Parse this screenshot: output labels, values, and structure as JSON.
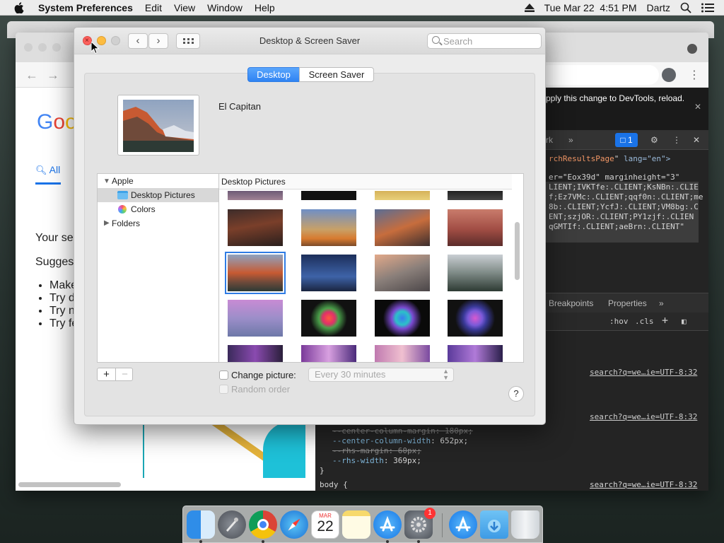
{
  "menubar": {
    "app": "System Preferences",
    "items": [
      "Edit",
      "View",
      "Window",
      "Help"
    ],
    "datetime": "Tue Mar 22  4:51 PM",
    "user": "Dartz"
  },
  "window": {
    "title": "Desktop & Screen Saver",
    "search_placeholder": "Search",
    "tabs": [
      "Desktop",
      "Screen Saver"
    ],
    "selected_tab": "Desktop",
    "current_picture": "El Capitan",
    "source_list": {
      "apple": "Apple",
      "desktop_pictures": "Desktop Pictures",
      "colors": "Colors",
      "folders": "Folders"
    },
    "grid_header": "Desktop Pictures",
    "plus": "+",
    "minus": "−",
    "change_picture_label": "Change picture:",
    "change_picture_interval": "Every 30 minutes",
    "random_order_label": "Random order",
    "help": "?"
  },
  "chrome": {
    "search_tab_all": "All",
    "result_text_1": "Your se",
    "result_text_2": "Sugges",
    "bullets": [
      "Make",
      "Try d",
      "Try n",
      "Try fe"
    ]
  },
  "devtools": {
    "message": "pply this change to DevTools, reload.",
    "tab_partial": "rk",
    "badge_count": "1",
    "html_line_1_attr": "rchResultsPage",
    "html_line_1_lang": "lang=\"en\">",
    "html_lines": [
      "er=\"Eox39d\" marginheight=\"3\"",
      "LIENT;IVKTfe:.CLIENT;KsNBn:.CLIE",
      "f;Ez7VMc:.CLIENT;qqf0n:.CLIENT;me",
      "8b:.CLIENT;YcfJ:.CLIENT;VM8bg:.C",
      "ENT;szjOR:.CLIENT;PY1zjf:.CLIEN",
      "qGMTIf:.CLIENT;aeBrn:.CLIENT\""
    ],
    "subtabs": [
      "Breakpoints",
      "Properties"
    ],
    "filter_hov": ":hov",
    "filter_cls": ".cls",
    "link": "search?q=we…ie=UTF-8:32",
    "css_lines": [
      {
        "prop": "--center-column-margin",
        "val": "180px;",
        "struck": true
      },
      {
        "prop": "--center-column-width",
        "val": "652px;",
        "struck": false
      },
      {
        "prop": "--rhs-margin",
        "val": "60px;",
        "struck": true
      },
      {
        "prop": "--rhs-width",
        "val": "369px;",
        "struck": false
      }
    ],
    "close_brace": "}",
    "body_rule": "body {"
  },
  "dock": {
    "apps": [
      "Finder",
      "Launchpad",
      "Chrome",
      "Safari",
      "Calendar",
      "Notes",
      "App Store",
      "System Preferences",
      "AppStore Downloads",
      "Downloads",
      "Trash"
    ],
    "calendar_month": "MAR",
    "calendar_day": "22",
    "prefs_badge": "1"
  },
  "colors": {
    "accent": "#2f83f3",
    "close": "#fc605c",
    "minimize": "#fdbc40"
  }
}
